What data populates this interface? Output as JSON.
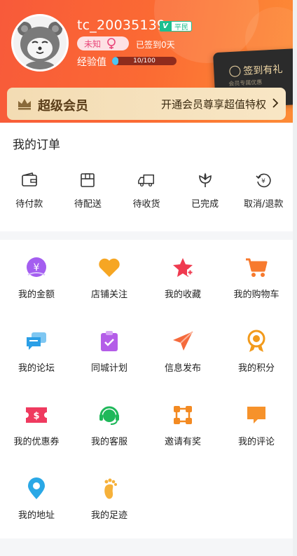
{
  "profile": {
    "username": "tc_20035139",
    "vip_badge": "V",
    "vip_level": "平民",
    "gender": "未知",
    "signed_in": "已签到0天",
    "exp_label": "经验值",
    "exp_text": "10/100",
    "exp_progress": 0.1
  },
  "signin": {
    "label": "签到有礼",
    "sub": "会员专属优惠"
  },
  "vip": {
    "title": "超级会员",
    "promo": "开通会员尊享超值特权"
  },
  "orders": {
    "title": "我的订单",
    "items": [
      {
        "label": "待付款",
        "icon": "wallet-icon"
      },
      {
        "label": "待配送",
        "icon": "box-icon"
      },
      {
        "label": "待收货",
        "icon": "truck-icon"
      },
      {
        "label": "已完成",
        "icon": "flower-icon"
      },
      {
        "label": "取消/退款",
        "icon": "refund-icon"
      }
    ]
  },
  "services": [
    {
      "label": "我的金额",
      "icon": "yen-coin-icon",
      "color": "#9b59e8"
    },
    {
      "label": "店铺关注",
      "icon": "heart-icon",
      "color": "#f6a623"
    },
    {
      "label": "我的收藏",
      "icon": "star-plus-icon",
      "color": "#ef3a4f"
    },
    {
      "label": "我的购物车",
      "icon": "cart-icon",
      "color": "#f77a2e"
    },
    {
      "label": "我的论坛",
      "icon": "chat-icon",
      "color": "#2b9fe6"
    },
    {
      "label": "同城计划",
      "icon": "clipboard-check-icon",
      "color": "#b45de8"
    },
    {
      "label": "信息发布",
      "icon": "paper-plane-icon",
      "color": "#f56a3c"
    },
    {
      "label": "我的积分",
      "icon": "medal-icon",
      "color": "#f29a1b"
    },
    {
      "label": "我的优惠券",
      "icon": "coupon-icon",
      "color": "#ef3a5f"
    },
    {
      "label": "我的客服",
      "icon": "headset-icon",
      "color": "#1fb85a"
    },
    {
      "label": "邀请有奖",
      "icon": "nodes-icon",
      "color": "#f38a22"
    },
    {
      "label": "我的评论",
      "icon": "comment-icon",
      "color": "#f6922b"
    },
    {
      "label": "我的地址",
      "icon": "location-pin-icon",
      "color": "#2aa8e6"
    },
    {
      "label": "我的足迹",
      "icon": "footprint-icon",
      "color": "#f6b13a"
    }
  ]
}
